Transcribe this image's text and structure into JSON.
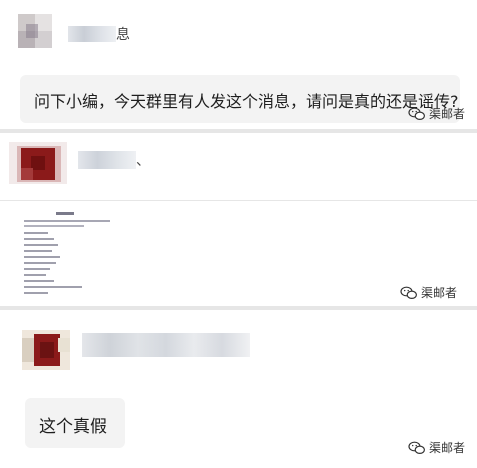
{
  "posts": [
    {
      "username": "",
      "tail": "息",
      "message": "问下小编，今天群里有人发这个消息，请问是真的还是谣传?",
      "watermark": "渠邮者"
    },
    {
      "username": "",
      "tail": "、",
      "watermark": "渠邮者"
    },
    {
      "username": "",
      "message": "这个真假",
      "watermark": "渠邮者"
    }
  ],
  "colors": {
    "bubble": "#f3f3f3",
    "avatar_red": "#8b1a1a",
    "divider": "#e6e6e6"
  },
  "icons": [
    "wechat-logo-icon"
  ]
}
